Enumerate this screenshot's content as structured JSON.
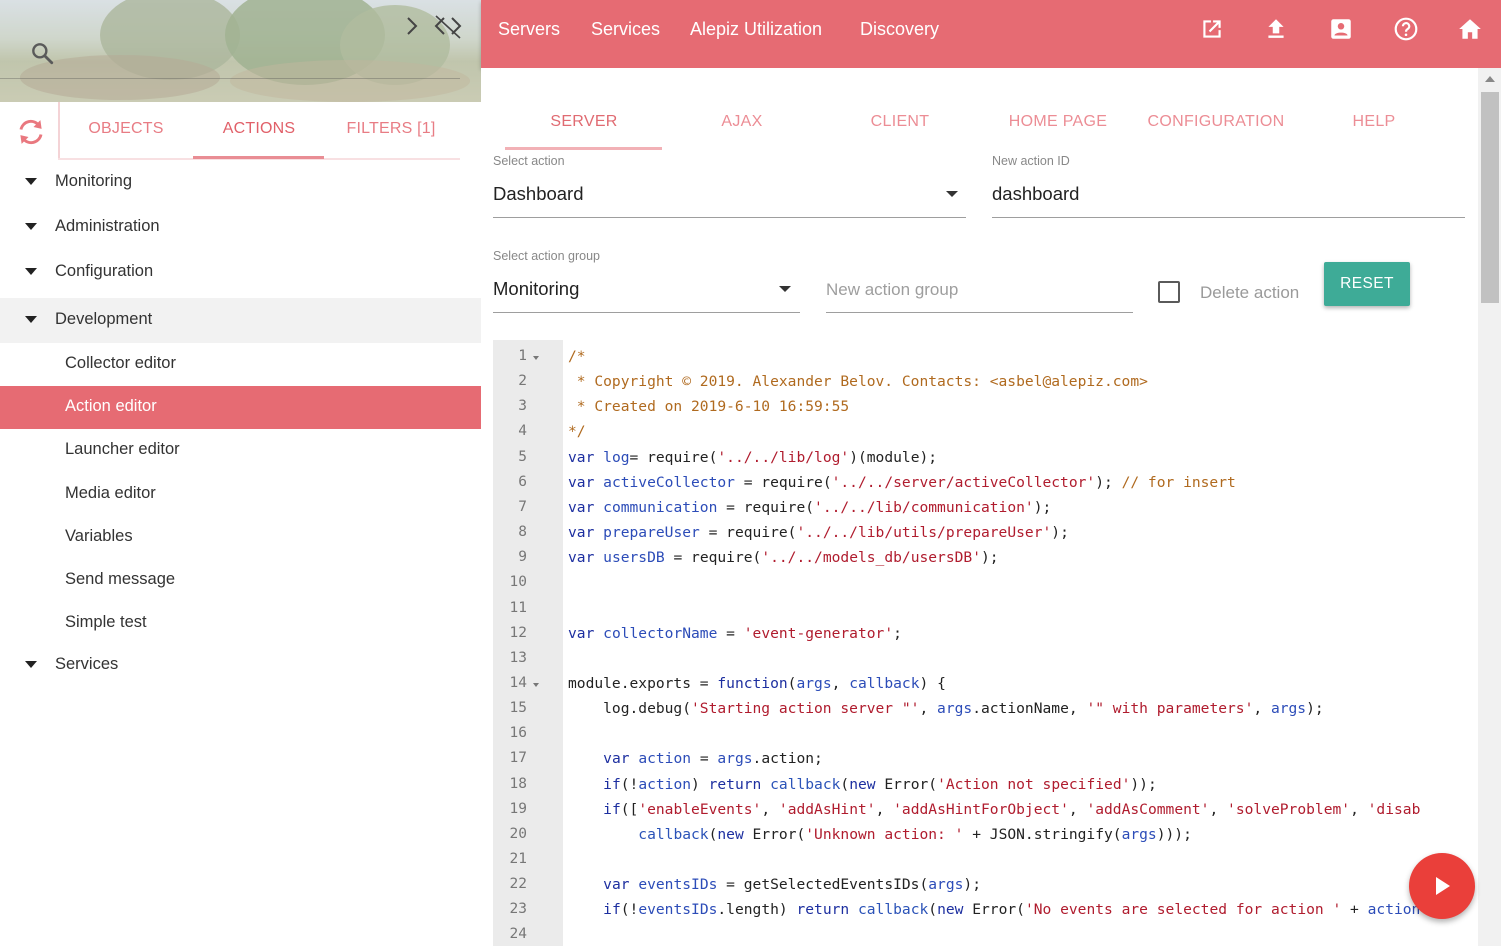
{
  "sidebar": {
    "search_icon": "search-icon",
    "collapse_icon": "collapse-arrows-icon",
    "refresh_icon": "refresh-icon",
    "tabs": [
      {
        "label": "OBJECTS"
      },
      {
        "label": "ACTIONS",
        "active": true
      },
      {
        "label": "FILTERS [1]"
      }
    ],
    "tree": [
      {
        "label": "Monitoring",
        "expandable": true
      },
      {
        "label": "Administration",
        "expandable": true
      },
      {
        "label": "Configuration",
        "expandable": true
      },
      {
        "label": "Development",
        "expandable": true,
        "expanded": true
      },
      {
        "label": "Collector editor"
      },
      {
        "label": "Action editor",
        "selected": true
      },
      {
        "label": "Launcher editor"
      },
      {
        "label": "Media editor"
      },
      {
        "label": "Variables"
      },
      {
        "label": "Send message"
      },
      {
        "label": "Simple test"
      },
      {
        "label": "Services",
        "expandable": true
      }
    ]
  },
  "topnav": {
    "links": [
      {
        "label": "Servers"
      },
      {
        "label": "Services"
      },
      {
        "label": "Alepiz Utilization"
      },
      {
        "label": "Discovery"
      }
    ],
    "icons": [
      "open-in-new-icon",
      "upload-icon",
      "account-box-icon",
      "help-icon",
      "home-icon"
    ]
  },
  "main": {
    "tabs": [
      {
        "label": "SERVER",
        "active": true
      },
      {
        "label": "AJAX"
      },
      {
        "label": "CLIENT"
      },
      {
        "label": "HOME PAGE"
      },
      {
        "label": "CONFIGURATION"
      },
      {
        "label": "HELP"
      }
    ],
    "select_action": {
      "label": "Select action",
      "value": "Dashboard"
    },
    "new_action_id": {
      "label": "New action ID",
      "value": "dashboard"
    },
    "select_action_group": {
      "label": "Select action group",
      "value": "Monitoring"
    },
    "new_action_group": {
      "placeholder": "New action group",
      "value": ""
    },
    "delete_action": {
      "label": "Delete action",
      "checked": false
    },
    "reset_label": "RESET"
  },
  "editor": {
    "line_numbers": [
      "1",
      "2",
      "3",
      "4",
      "5",
      "6",
      "7",
      "8",
      "9",
      "10",
      "11",
      "12",
      "13",
      "14",
      "15",
      "16",
      "17",
      "18",
      "19",
      "20",
      "21",
      "22",
      "23",
      "24"
    ],
    "foldable_lines": [
      1,
      14
    ],
    "lines": [
      [
        [
          "cmt",
          "/*"
        ]
      ],
      [
        [
          "cmt",
          " * Copyright © 2019. Alexander Belov. Contacts: <asbel@alepiz.com>"
        ]
      ],
      [
        [
          "cmt",
          " * Created on 2019-6-10 16:59:55"
        ]
      ],
      [
        [
          "cmt",
          "*/"
        ]
      ],
      [
        [
          "kw",
          "var "
        ],
        [
          "vr",
          "log"
        ],
        [
          "",
          "= require("
        ],
        [
          "st",
          "'../../lib/log'"
        ],
        [
          "",
          ")(module);"
        ]
      ],
      [
        [
          "kw",
          "var "
        ],
        [
          "vr",
          "activeCollector"
        ],
        [
          "",
          " = require("
        ],
        [
          "st",
          "'../../server/activeCollector'"
        ],
        [
          "",
          "); "
        ],
        [
          "cmt",
          "// for insert"
        ]
      ],
      [
        [
          "kw",
          "var "
        ],
        [
          "vr",
          "communication"
        ],
        [
          "",
          " = require("
        ],
        [
          "st",
          "'../../lib/communication'"
        ],
        [
          "",
          ");"
        ]
      ],
      [
        [
          "kw",
          "var "
        ],
        [
          "vr",
          "prepareUser"
        ],
        [
          "",
          " = require("
        ],
        [
          "st",
          "'../../lib/utils/prepareUser'"
        ],
        [
          "",
          ");"
        ]
      ],
      [
        [
          "kw",
          "var "
        ],
        [
          "vr",
          "usersDB"
        ],
        [
          "",
          " = require("
        ],
        [
          "st",
          "'../../models_db/usersDB'"
        ],
        [
          "",
          ");"
        ]
      ],
      [],
      [],
      [
        [
          "kw",
          "var "
        ],
        [
          "vr",
          "collectorName"
        ],
        [
          "",
          " = "
        ],
        [
          "st",
          "'event-generator'"
        ],
        [
          "",
          ";"
        ]
      ],
      [],
      [
        [
          "",
          "module.exports = "
        ],
        [
          "kw",
          "function"
        ],
        [
          "",
          "("
        ],
        [
          "vr",
          "args"
        ],
        [
          "",
          ", "
        ],
        [
          "vr",
          "callback"
        ],
        [
          "",
          ") {"
        ]
      ],
      [
        [
          "",
          "    log.debug("
        ],
        [
          "st",
          "'Starting action server \"'"
        ],
        [
          "",
          ", "
        ],
        [
          "vr",
          "args"
        ],
        [
          "",
          ".actionName, "
        ],
        [
          "st",
          "'\" with parameters'"
        ],
        [
          "",
          ", "
        ],
        [
          "vr",
          "args"
        ],
        [
          "",
          ");"
        ]
      ],
      [],
      [
        [
          "",
          "    "
        ],
        [
          "kw",
          "var "
        ],
        [
          "vr",
          "action"
        ],
        [
          "",
          " = "
        ],
        [
          "vr",
          "args"
        ],
        [
          "",
          ".action;"
        ]
      ],
      [
        [
          "",
          "    "
        ],
        [
          "kw",
          "if"
        ],
        [
          "",
          "(!"
        ],
        [
          "vr",
          "action"
        ],
        [
          "",
          ") "
        ],
        [
          "kw",
          "return "
        ],
        [
          "fn",
          "callback"
        ],
        [
          "",
          "("
        ],
        [
          "kw",
          "new "
        ],
        [
          "",
          "Error("
        ],
        [
          "st",
          "'Action not specified'"
        ],
        [
          "",
          "));"
        ]
      ],
      [
        [
          "",
          "    "
        ],
        [
          "kw",
          "if"
        ],
        [
          "",
          "(["
        ],
        [
          "st",
          "'enableEvents'"
        ],
        [
          "",
          ", "
        ],
        [
          "st",
          "'addAsHint'"
        ],
        [
          "",
          ", "
        ],
        [
          "st",
          "'addAsHintForObject'"
        ],
        [
          "",
          ", "
        ],
        [
          "st",
          "'addAsComment'"
        ],
        [
          "",
          ", "
        ],
        [
          "st",
          "'solveProblem'"
        ],
        [
          "",
          ", "
        ],
        [
          "st",
          "'disab"
        ]
      ],
      [
        [
          "",
          "        "
        ],
        [
          "fn",
          "callback"
        ],
        [
          "",
          "("
        ],
        [
          "kw",
          "new "
        ],
        [
          "",
          "Error("
        ],
        [
          "st",
          "'Unknown action: '"
        ],
        [
          "",
          " + JSON.stringify("
        ],
        [
          "vr",
          "args"
        ],
        [
          "",
          ")));"
        ]
      ],
      [],
      [
        [
          "",
          "    "
        ],
        [
          "kw",
          "var "
        ],
        [
          "vr",
          "eventsIDs"
        ],
        [
          "",
          " = getSelectedEventsIDs("
        ],
        [
          "vr",
          "args"
        ],
        [
          "",
          ");"
        ]
      ],
      [
        [
          "",
          "    "
        ],
        [
          "kw",
          "if"
        ],
        [
          "",
          "(!"
        ],
        [
          "vr",
          "eventsIDs"
        ],
        [
          "",
          ".length) "
        ],
        [
          "kw",
          "return "
        ],
        [
          "fn",
          "callback"
        ],
        [
          "",
          "("
        ],
        [
          "kw",
          "new "
        ],
        [
          "",
          "Error("
        ],
        [
          "st",
          "'No events are selected for action '"
        ],
        [
          "",
          " + "
        ],
        [
          "vr",
          "action"
        ]
      ],
      []
    ]
  },
  "run_button_icon": "play-icon",
  "colors": {
    "accent": "#e66b73",
    "reset_button": "#3eab97",
    "run_button": "#ea3f3a"
  }
}
